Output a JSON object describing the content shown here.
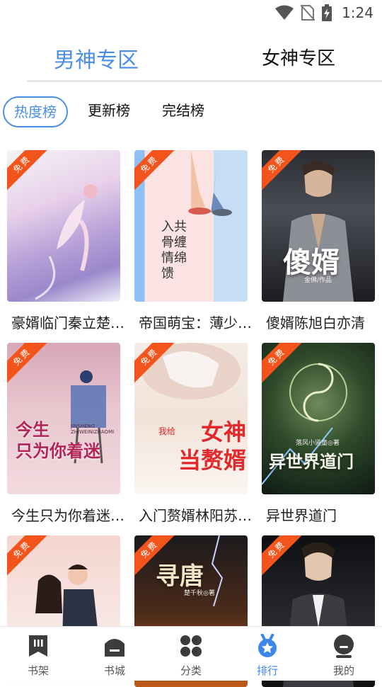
{
  "status_bar": {
    "time": "1:24"
  },
  "top_tabs": [
    {
      "label": "男神专区",
      "active": true
    },
    {
      "label": "女神专区",
      "active": false
    }
  ],
  "sub_tabs": [
    {
      "label": "热度榜",
      "active": true
    },
    {
      "label": "更新榜",
      "active": false
    },
    {
      "label": "完结榜",
      "active": false
    }
  ],
  "badge_label": "免费",
  "books": [
    {
      "title": "豪婿临门秦立楚…"
    },
    {
      "title": "帝国萌宝：薄少…",
      "cover_text": "入共\n骨缠\n情绵\n馈"
    },
    {
      "title": "傻婿陈旭白亦清",
      "cover_text": "傻婿",
      "cover_sub": "金佛/作品"
    },
    {
      "title": "今生只为你着迷…",
      "cover_text": "今生\n只为你着迷",
      "cover_sub": "JINSHENG ZHIWEINIZHAOMI"
    },
    {
      "title": "入门赘婿林阳苏…",
      "cover_text": "女神\n当赘婿",
      "cover_sub": "我给"
    },
    {
      "title": "异世界道门",
      "cover_text": "异世界道门",
      "cover_sub": "落风小道童◎著"
    },
    {
      "title": "",
      "cover_text": ""
    },
    {
      "title": "",
      "cover_text": "寻唐",
      "cover_sub": "楚千秋◎著"
    },
    {
      "title": "",
      "cover_text": ""
    }
  ],
  "bottom_nav": [
    {
      "label": "书架",
      "icon": "bookshelf-icon",
      "active": false
    },
    {
      "label": "书城",
      "icon": "bookstore-icon",
      "active": false
    },
    {
      "label": "分类",
      "icon": "category-icon",
      "active": false
    },
    {
      "label": "排行",
      "icon": "ranking-icon",
      "active": true
    },
    {
      "label": "我的",
      "icon": "profile-icon",
      "active": false
    }
  ],
  "colors": {
    "accent": "#4a8ee6",
    "badge": "#f2541b",
    "nav_inactive": "#3c3c3c",
    "nav_active": "#3d86ea"
  }
}
